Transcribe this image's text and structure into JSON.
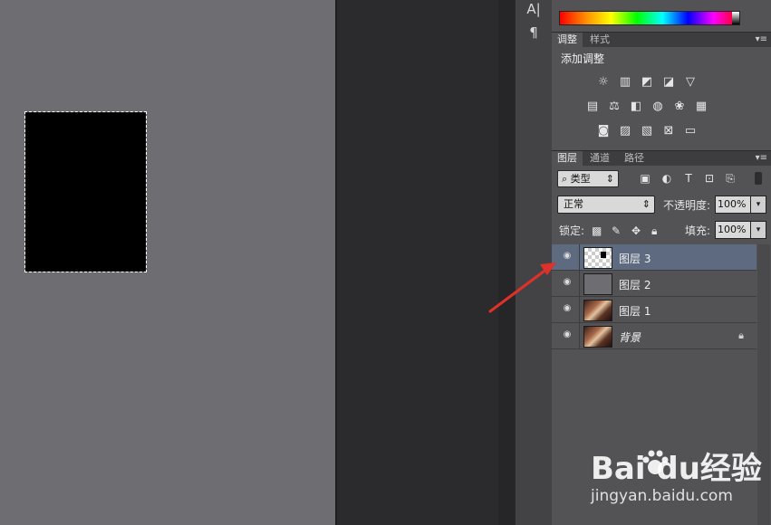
{
  "toolstrip": {
    "tools": [
      "A|",
      "¶"
    ]
  },
  "adjustments_panel": {
    "tabs": [
      "调整",
      "样式"
    ],
    "title": "添加调整",
    "icons_row1": [
      "brightness-icon",
      "levels-icon",
      "curves-icon",
      "exposure-icon",
      "vibrance-icon"
    ],
    "icons_row2": [
      "hue-saturation-icon",
      "color-balance-icon",
      "black-white-icon",
      "photo-filter-icon",
      "channel-mixer-icon",
      "color-lookup-icon"
    ],
    "icons_row3": [
      "invert-icon",
      "posterize-icon",
      "threshold-icon",
      "selective-color-icon",
      "gradient-map-icon"
    ]
  },
  "layers_panel": {
    "tabs": [
      "图层",
      "通道",
      "路径"
    ],
    "filter_label": "类型",
    "blend_mode": "正常",
    "opacity_label": "不透明度:",
    "opacity_value": "100%",
    "lock_label": "锁定:",
    "fill_label": "填充:",
    "fill_value": "100%",
    "layers": [
      {
        "name": "图层 3",
        "thumb": "check",
        "selected": true
      },
      {
        "name": "图层 2",
        "thumb": "gray",
        "selected": false
      },
      {
        "name": "图层 1",
        "thumb": "photo",
        "selected": false
      },
      {
        "name": "背景",
        "thumb": "photo",
        "selected": false,
        "locked": true
      }
    ]
  },
  "watermark": {
    "logo": "Bai  du经验",
    "url": "jingyan.baidu.com"
  },
  "colors": {
    "selected_layer": "#5d6a7f",
    "panel_bg": "#535356",
    "canvas": "#6e6d71",
    "arrow": "#e0302a"
  }
}
